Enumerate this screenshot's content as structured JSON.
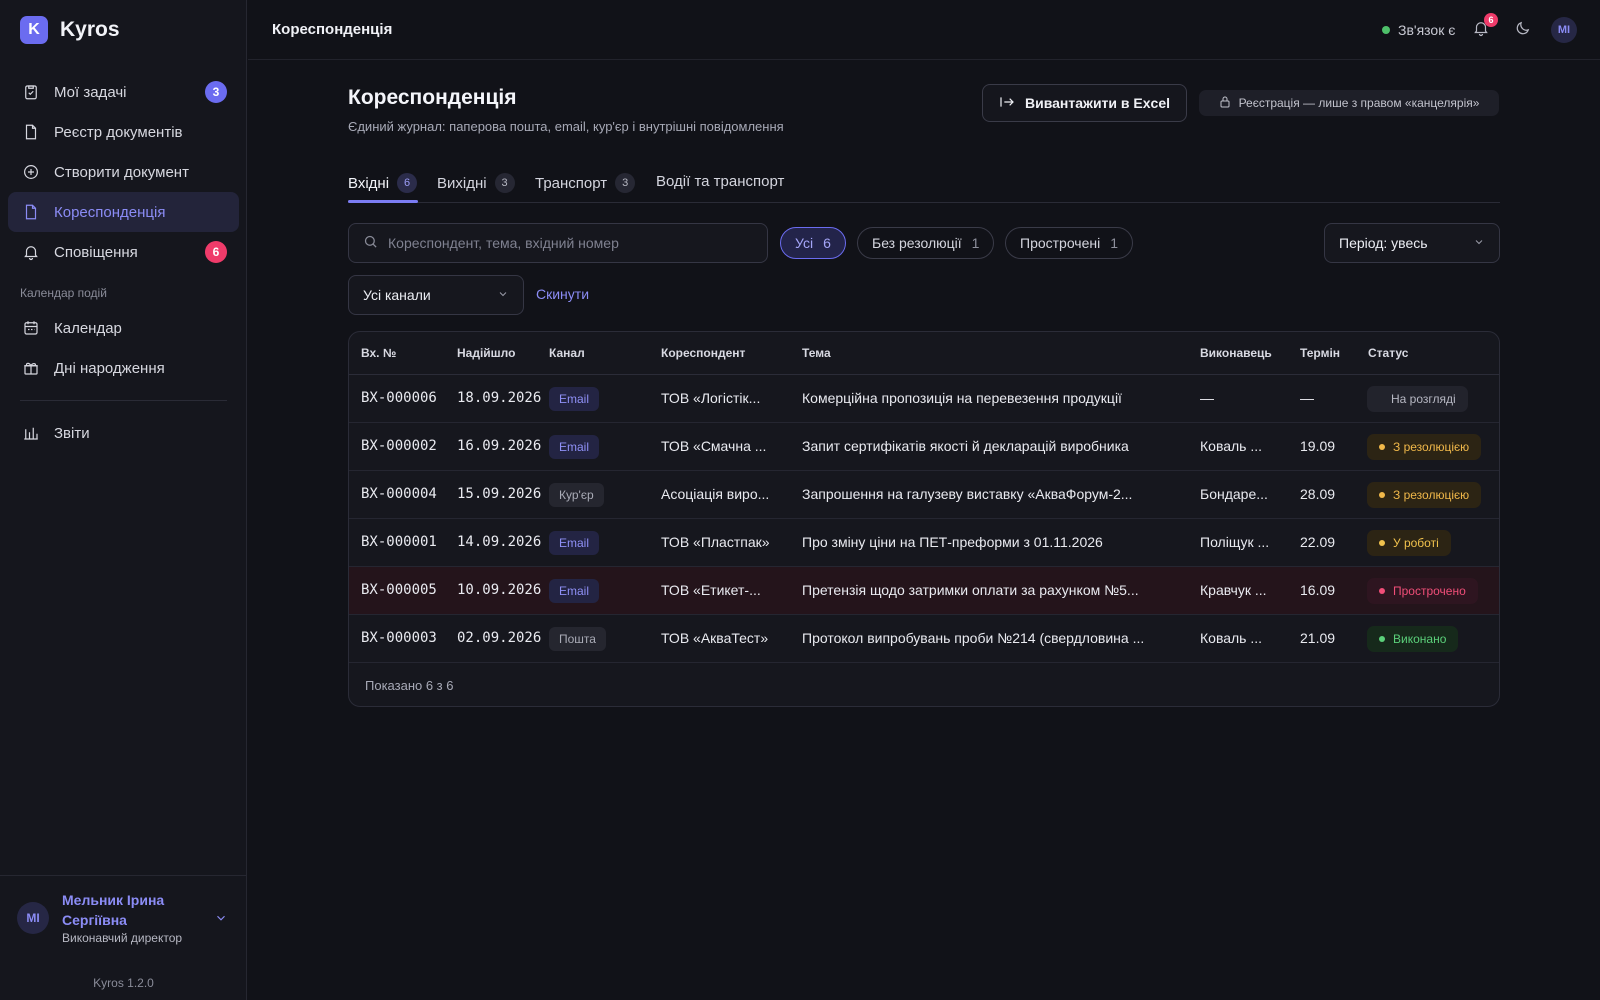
{
  "app": {
    "name": "Kyros",
    "logo_letter": "K",
    "version": "Kyros 1.2.0"
  },
  "sidebar": {
    "items": [
      {
        "label": "Мої задачі",
        "icon": "clipboard-check-icon",
        "badge": "3",
        "badge_color": "#6b6cf0"
      },
      {
        "label": "Реєстр документів",
        "icon": "document-icon"
      },
      {
        "label": "Створити документ",
        "icon": "plus-circle-icon"
      },
      {
        "label": "Кореспонденція",
        "icon": "document-icon",
        "active": true
      },
      {
        "label": "Сповіщення",
        "icon": "bell-icon",
        "badge": "6",
        "badge_color": "#ef3b6a"
      }
    ],
    "section_label": "Календар подій",
    "calendar_items": [
      {
        "label": "Календар",
        "icon": "calendar-icon"
      },
      {
        "label": "Дні народження",
        "icon": "gift-icon"
      }
    ],
    "bottom_items": [
      {
        "label": "Звіти",
        "icon": "bar-chart-icon"
      }
    ]
  },
  "user": {
    "initials": "МІ",
    "name": "Мельник Ірина Сергіївна",
    "role": "Виконавчий директор"
  },
  "topbar": {
    "title": "Кореспонденція",
    "connection": "Зв'язок є",
    "connection_color": "#4ec06a",
    "notifications_count": "6",
    "avatar_initials": "МІ"
  },
  "main": {
    "title": "Кореспонденція",
    "subtitle": "Єдиний журнал: паперова пошта, email, кур'єр і внутрішні повідомлення",
    "export_label": "Вивантажити в Excel",
    "registration_note": "Реєстрація — лише з правом «канцелярія»",
    "tabs": [
      {
        "label": "Вхідні",
        "count": "6",
        "active": true
      },
      {
        "label": "Вихідні",
        "count": "3"
      },
      {
        "label": "Транспорт",
        "count": "3"
      },
      {
        "label": "Водії та транспорт"
      }
    ],
    "search_placeholder": "Кореспондент, тема, вхідний номер",
    "filters": [
      {
        "label": "Усі",
        "count": "6",
        "active": true
      },
      {
        "label": "Без резолюції",
        "count": "1"
      },
      {
        "label": "Прострочені",
        "count": "1"
      }
    ],
    "period": "Період: увесь",
    "channel": "Усі канали",
    "reset_label": "Скинути"
  },
  "table": {
    "columns": [
      "Вх. №",
      "Надійшло",
      "Канал",
      "Кореспондент",
      "Тема",
      "Виконавець",
      "Термін",
      "Статус"
    ],
    "rows": [
      {
        "no": "ВХ-000006",
        "date": "18.09.2026",
        "channel": "Email",
        "correspondent": "ТОВ «Логістік...",
        "subject": "Комерційна пропозиція на перевезення продукції",
        "executor": "—",
        "deadline": "—",
        "status": "На розгляді",
        "status_kind": "neutral"
      },
      {
        "no": "ВХ-000002",
        "date": "16.09.2026",
        "channel": "Email",
        "correspondent": "ТОВ «Смачна ...",
        "subject": "Запит сертифікатів якості й декларацій виробника",
        "executor": "Коваль ...",
        "deadline": "19.09",
        "status": "З резолюцією",
        "status_kind": "resolution"
      },
      {
        "no": "ВХ-000004",
        "date": "15.09.2026",
        "channel": "Кур'єр",
        "correspondent": "Асоціація виро...",
        "subject": "Запрошення на галузеву виставку «АкваФорум-2...",
        "executor": "Бондаре...",
        "deadline": "28.09",
        "status": "З резолюцією",
        "status_kind": "resolution"
      },
      {
        "no": "ВХ-000001",
        "date": "14.09.2026",
        "channel": "Email",
        "correspondent": "ТОВ «Пластпак»",
        "subject": "Про зміну ціни на ПЕТ-преформи з 01.11.2026",
        "executor": "Поліщук ...",
        "deadline": "22.09",
        "status": "У роботі",
        "status_kind": "work"
      },
      {
        "no": "ВХ-000005",
        "date": "10.09.2026",
        "channel": "Email",
        "correspondent": "ТОВ «Етикет-...",
        "subject": "Претензія щодо затримки оплати за рахунком №5...",
        "executor": "Кравчук ...",
        "deadline": "16.09",
        "status": "Прострочено",
        "status_kind": "overdue"
      },
      {
        "no": "ВХ-000003",
        "date": "02.09.2026",
        "channel": "Пошта",
        "correspondent": "ТОВ «АкваТест»",
        "subject": "Протокол випробувань проби №214 (свердловина ...",
        "executor": "Коваль ...",
        "deadline": "21.09",
        "status": "Виконано",
        "status_kind": "done"
      }
    ],
    "footer": "Показано 6 з 6"
  }
}
